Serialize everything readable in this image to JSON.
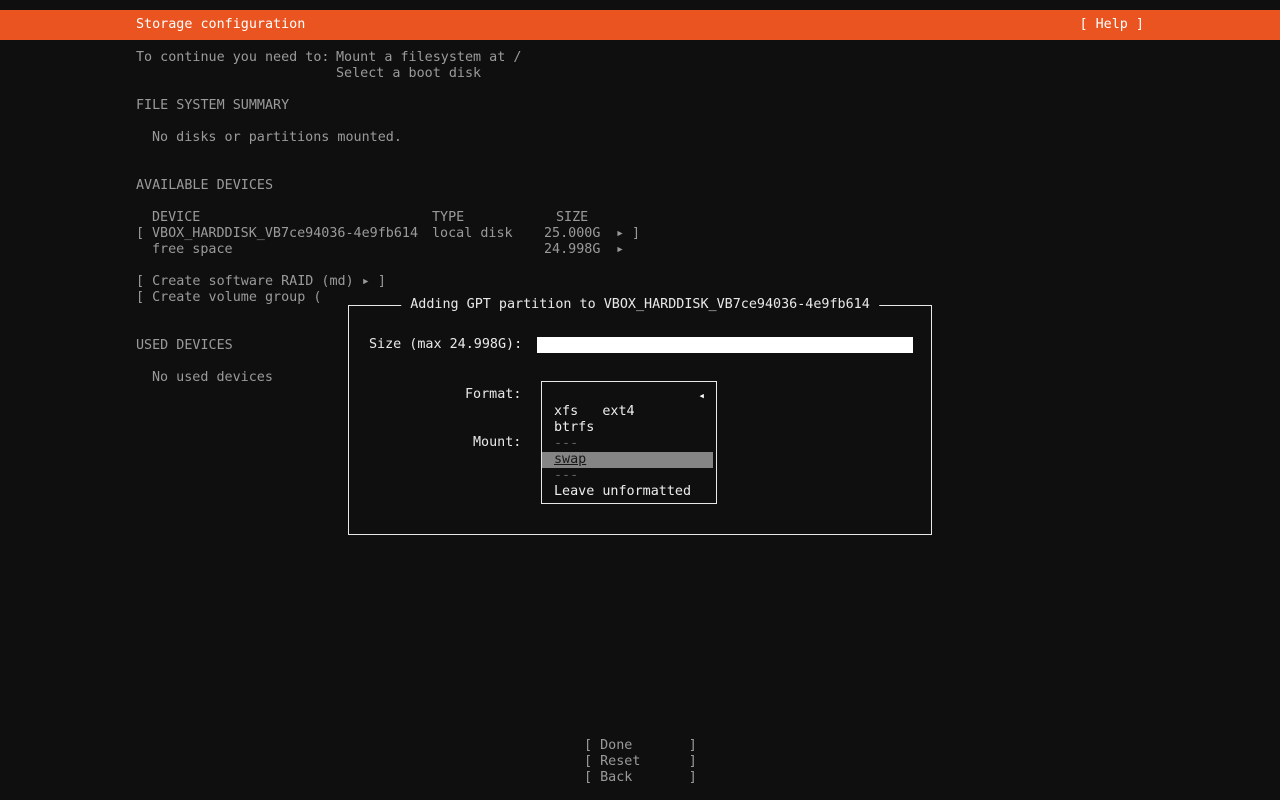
{
  "topbar": {
    "title": "Storage configuration",
    "help_label": "[ Help ]"
  },
  "intro": {
    "label": "To continue you need to:",
    "line1": "Mount a filesystem at /",
    "line2": "Select a boot disk"
  },
  "file_system_summary": {
    "heading": "FILE SYSTEM SUMMARY",
    "empty_message": "No disks or partitions mounted."
  },
  "available_devices": {
    "heading": "AVAILABLE DEVICES",
    "columns": {
      "device": "DEVICE",
      "type": "TYPE",
      "size": "SIZE"
    },
    "disk_row": {
      "open_bracket": "[",
      "name": "VBOX_HARDDISK_VB7ce94036-4e9fb614",
      "type": "local disk",
      "size": "25.000G",
      "arrow": "▸",
      "close_bracket": "]"
    },
    "free_space_row": {
      "name": "free space",
      "size": "24.998G",
      "arrow": "▸"
    },
    "create_raid_label": "[ Create software RAID (md) ▸ ]",
    "create_vg_label_visible": "[ Create volume group ("
  },
  "used_devices": {
    "heading": "USED DEVICES",
    "empty_message": "No used devices"
  },
  "dialog": {
    "title": "Adding GPT partition to VBOX_HARDDISK_VB7ce94036-4e9fb614",
    "size_label": "Size (max 24.998G):",
    "size_value": "",
    "format_label": "Format:",
    "mount_label": "Mount:",
    "selected_marker": "◂",
    "format_options": [
      {
        "label": "ext4",
        "state": "selected"
      },
      {
        "label": "xfs",
        "state": "normal"
      },
      {
        "label": "btrfs",
        "state": "normal"
      },
      {
        "label": "---",
        "state": "dim"
      },
      {
        "label": "swap",
        "state": "focused"
      },
      {
        "label": "---",
        "state": "dim"
      },
      {
        "label": "Leave unformatted",
        "state": "normal"
      }
    ]
  },
  "buttons": {
    "done": "[ Done       ]",
    "reset": "[ Reset      ]",
    "back": "[ Back       ]"
  },
  "colors": {
    "accent_orange": "#E95420",
    "background": "#0f0f0f",
    "body_text": "#9a9a9a",
    "bright_text": "#e8e8e8",
    "dim_text": "#616161",
    "focus_highlight": "#858585",
    "input_background": "#ffffff"
  }
}
